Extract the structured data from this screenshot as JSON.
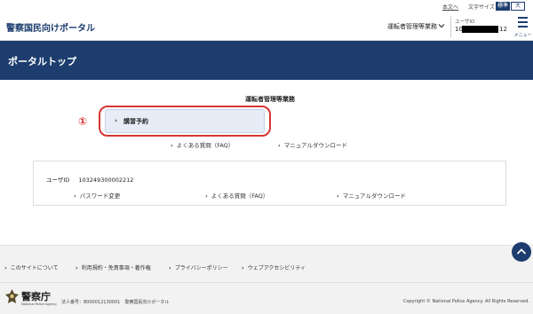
{
  "top_bar": {
    "honbun_link": "本文へ",
    "font_size_label": "文字サイズ",
    "font_standard": "標準",
    "font_large": "大"
  },
  "header": {
    "logo": "警察国民向けポータル",
    "business_select": "運転者管理等業務",
    "user_id_label": "ユーザID",
    "user_id_prefix": "10",
    "user_id_suffix": "12",
    "menu_label": "メニュー"
  },
  "banner": {
    "title": "ポータルトップ"
  },
  "main": {
    "section_title": "運転者管理等業務",
    "marker": "①",
    "primary_button": "講習予約",
    "faq_link": "よくある質問（FAQ）",
    "manual_link": "マニュアルダウンロード"
  },
  "user_card": {
    "user_id_label": "ユーザID",
    "user_id_value": "103249300002212",
    "links": [
      "パスワード変更",
      "よくある質問（FAQ）",
      "マニュアルダウンロード"
    ]
  },
  "footer_links": [
    "このサイトについて",
    "利用規約・免責事項・著作権",
    "プライバシーポリシー",
    "ウェブアクセシビリティ"
  ],
  "footer": {
    "agency_name": "警察庁",
    "agency_en": "National Police Agency",
    "corporate_number": "法人番号：8000012130001　警察国民向けポータル",
    "copyright": "Copyright © National Police Agency. All Rights Reserved."
  },
  "colors": {
    "brand_navy": "#1c3d6e",
    "highlight_red": "#d63535",
    "button_bg": "#e6edf7"
  }
}
